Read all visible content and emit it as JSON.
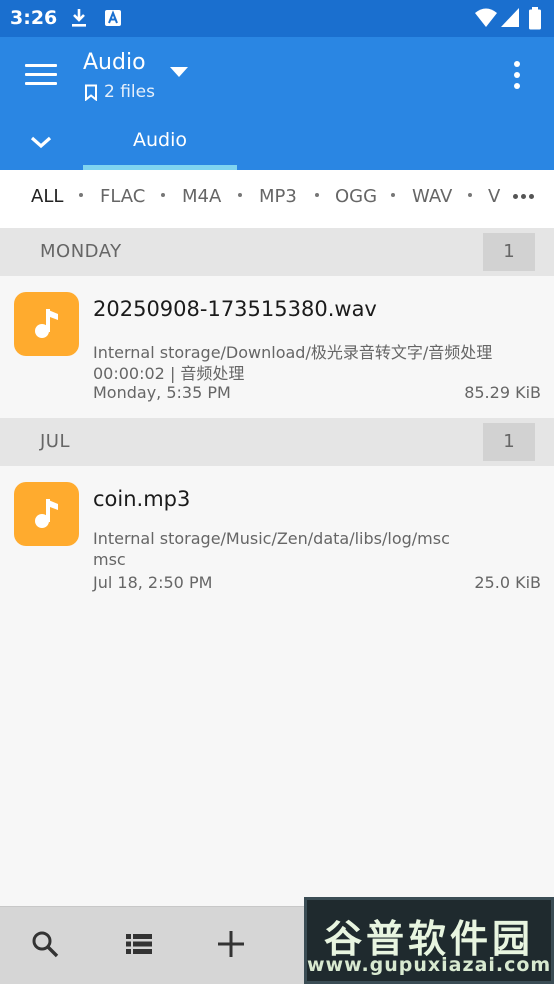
{
  "status_bar": {
    "time": "3:26",
    "left_icons": [
      "download-icon",
      "a-badge-icon"
    ],
    "right_icons": [
      "wifi-icon",
      "signal-icon",
      "battery-icon"
    ]
  },
  "app_bar": {
    "title": "Audio",
    "subtitle": "2 files",
    "menu_icon": "hamburger-icon",
    "overflow_icon": "kebab-icon",
    "color": "#2a86e3"
  },
  "tabs": {
    "items": [
      {
        "label": "Audio",
        "selected": true
      }
    ],
    "indicator_color": "#7fd4f0"
  },
  "filters": {
    "items": [
      "ALL",
      "FLAC",
      "M4A",
      "MP3",
      "OGG",
      "WAV",
      "V"
    ],
    "selected": "ALL"
  },
  "sections": [
    {
      "title": "MONDAY",
      "count": "1",
      "files": [
        {
          "name": "20250908-173515380.wav",
          "path": "Internal storage/Download/极光录音转文字/音频处理",
          "detail": "00:00:02 | 音频处理",
          "date": "Monday, 5:35 PM",
          "size": "85.29 KiB"
        }
      ]
    },
    {
      "title": "JUL",
      "count": "1",
      "files": [
        {
          "name": "coin.mp3",
          "path": "Internal storage/Music/Zen/data/libs/log/msc",
          "detail": "msc",
          "date": "Jul 18, 2:50 PM",
          "size": "25.0 KiB"
        }
      ]
    }
  ],
  "bottom_bar": {
    "icons": [
      "search-icon",
      "list-view-icon",
      "add-icon"
    ]
  },
  "watermark": {
    "title": "谷普软件园",
    "url": "www.gupuxiazai.com"
  },
  "colors": {
    "file_icon_bg": "#ffab2e",
    "status_bar": "#1a6fcf"
  }
}
